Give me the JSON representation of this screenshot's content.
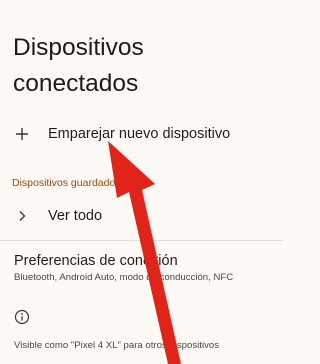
{
  "page": {
    "title": "Dispositivos conectados"
  },
  "pair_new_device": {
    "icon": "plus-icon",
    "label": "Emparejar nuevo dispositivo"
  },
  "saved_devices": {
    "header": "Dispositivos guardados",
    "see_all": {
      "icon": "chevron-right-icon",
      "label": "Ver todo"
    }
  },
  "connection_preferences": {
    "title": "Preferencias de conexión",
    "subtitle": "Bluetooth, Android Auto, modo de conducción, NFC"
  },
  "footer": {
    "icon": "info-icon",
    "text": "Visible como \"Pixel 4 XL\" para otros dispositivos"
  },
  "annotation": {
    "icon": "red-arrow",
    "color": "#e2231a"
  },
  "colors": {
    "background": "#fdf9f4",
    "section_header": "#9c4a12",
    "text": "#1f1f1f"
  }
}
